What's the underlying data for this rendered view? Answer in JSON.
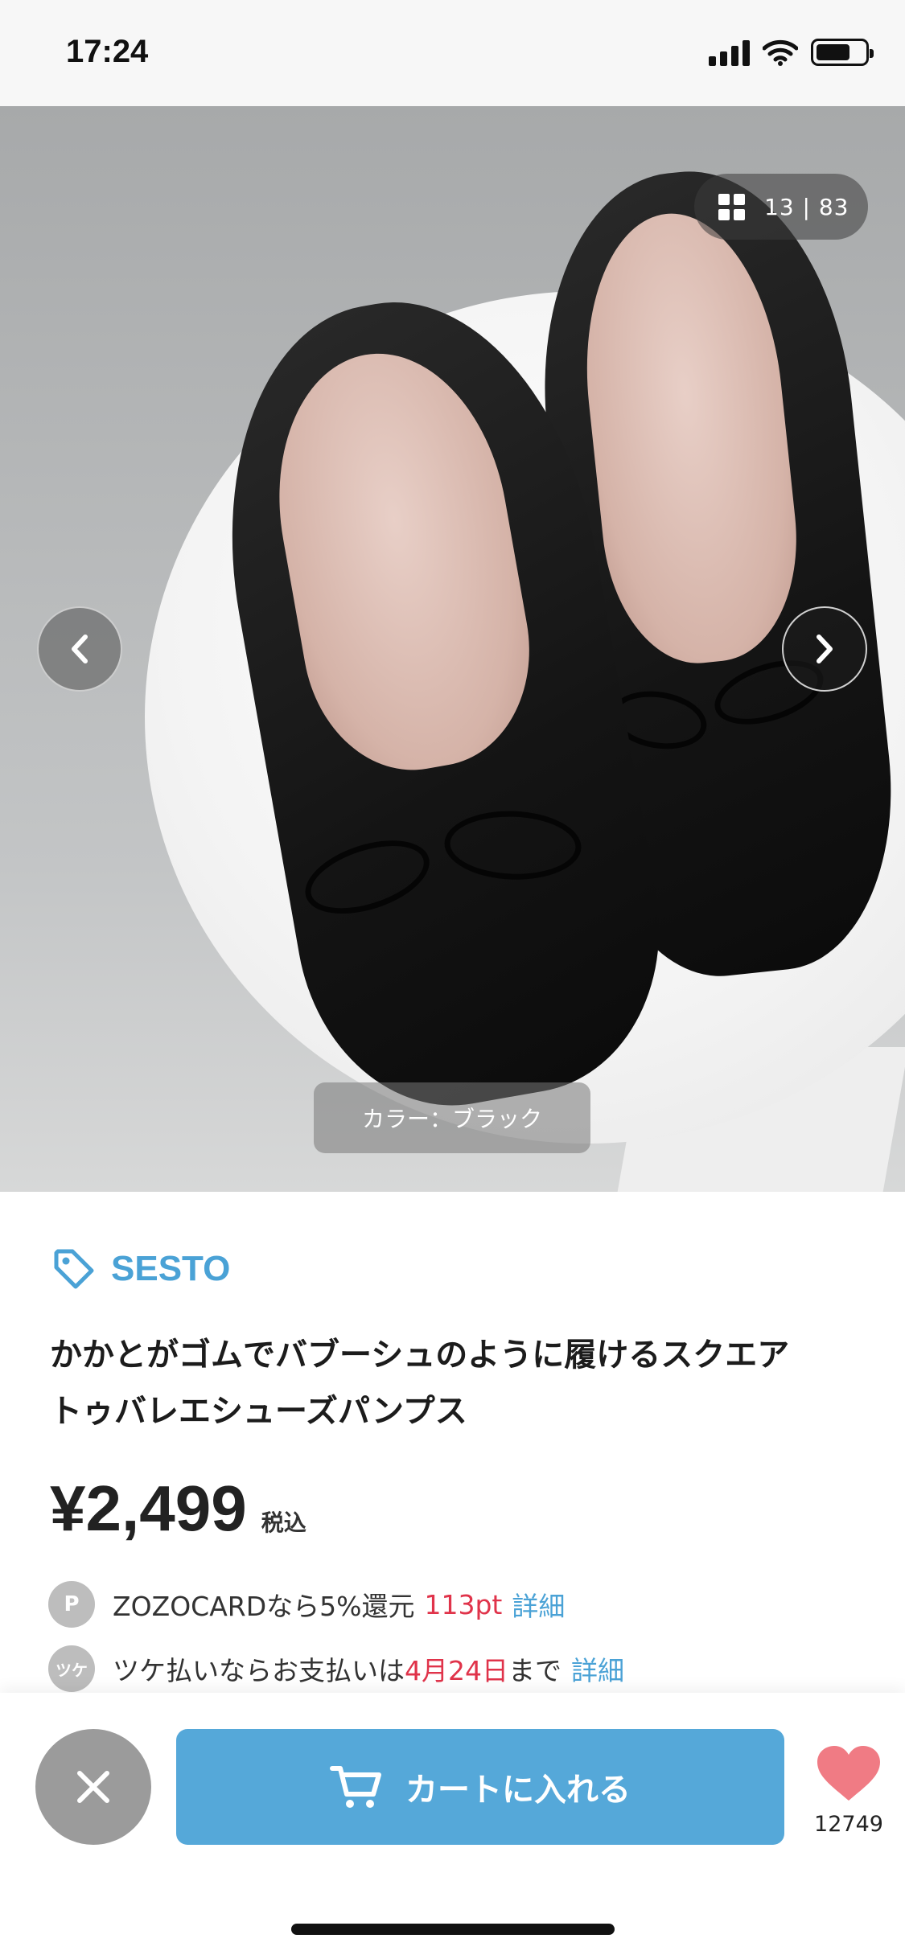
{
  "status_bar": {
    "time": "17:24",
    "battery_level": 0.7
  },
  "gallery": {
    "counter": "13 | 83",
    "color_label": "カラー：ブラック"
  },
  "product": {
    "brand": "SESTO",
    "title_line1": "かかとがゴムでバブーシュのように履けるスクエア",
    "title_line2": "トゥバレエシューズパンプス",
    "price": "¥2,499",
    "tax_label": "税込"
  },
  "points": {
    "icon": "P",
    "prefix": "ZOZOCARDなら5%還元",
    "amount": "113pt",
    "link": "詳細"
  },
  "tsuke": {
    "icon": "ツケ",
    "prefix": "ツケ払いならお支払いは",
    "date": "4月24日",
    "suffix": "まで",
    "link": "詳細"
  },
  "actions": {
    "cart_label": "カートに入れる",
    "favorite_count": "12749"
  },
  "colors": {
    "accent": "#4aa2d6",
    "cart": "#55a8d9",
    "sale_red": "#e0334a",
    "heart": "#f07b84"
  }
}
